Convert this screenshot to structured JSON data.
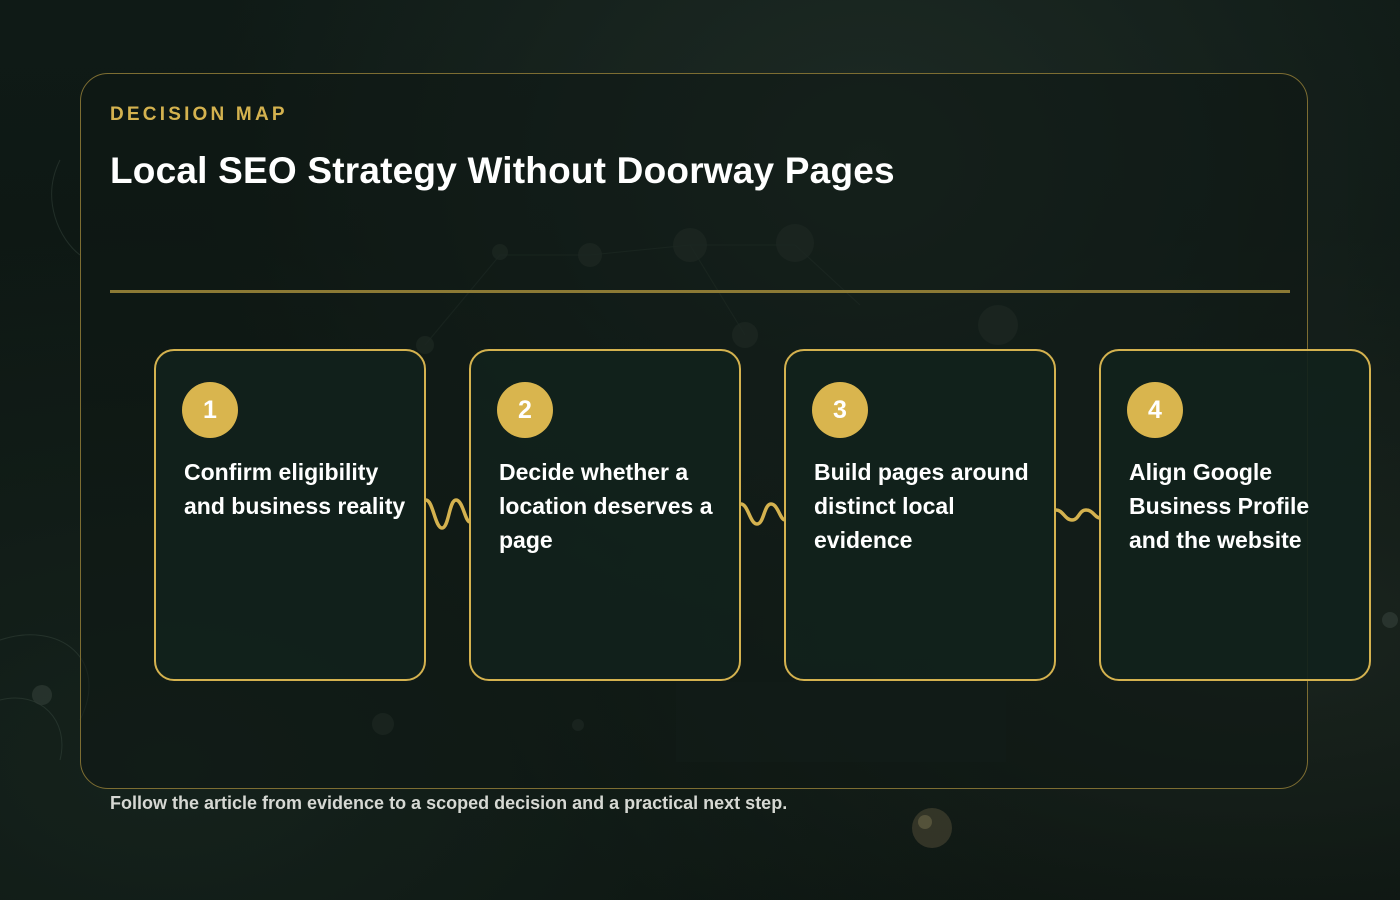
{
  "header": {
    "eyebrow": "DECISION MAP",
    "title": "Local SEO Strategy Without Doorway Pages"
  },
  "steps": [
    {
      "number": "1",
      "label": "Confirm eligibility and business reality"
    },
    {
      "number": "2",
      "label": "Decide whether a location deserves a page"
    },
    {
      "number": "3",
      "label": "Build pages around distinct local evidence"
    },
    {
      "number": "4",
      "label": "Align Google Business Profile and the website"
    }
  ],
  "footer": {
    "caption": "Follow the article from evidence to a scoped decision and a practical next step."
  },
  "colors": {
    "accent": "#d4b24f",
    "background": "#0d1612",
    "card": "#11211c",
    "text": "#ffffff"
  }
}
